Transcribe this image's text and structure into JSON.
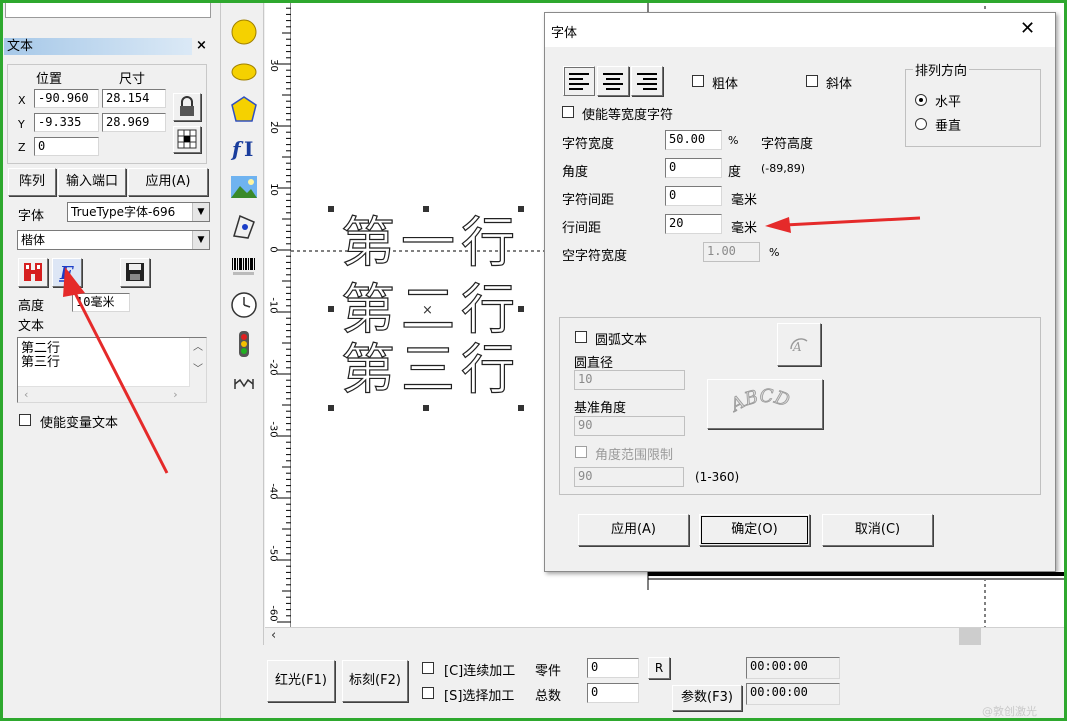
{
  "left_panel": {
    "title": "文本",
    "close": "×",
    "labels": {
      "position": "位置",
      "size": "尺寸",
      "x": "X",
      "y": "Y",
      "z": "Z"
    },
    "x_pos": "-90.960",
    "x_size": "28.154",
    "y_pos": "-9.335",
    "y_size": "28.969",
    "z_pos": "0",
    "buttons": {
      "array": "阵列",
      "input_port": "输入端口",
      "apply": "应用(A)"
    },
    "font_label": "字体",
    "font_type": "TrueType字体-696",
    "font_name": "楷体",
    "height_label": "高度",
    "height_value": "10毫米",
    "text_label": "文本",
    "text_lines": [
      "第二行",
      "第三行"
    ],
    "variable_text": "使能变量文本"
  },
  "canvas": {
    "lines": [
      "第一行",
      "第二行",
      "第三行"
    ],
    "ruler_labels": [
      "30",
      "20",
      "10",
      "0",
      "-10",
      "-20",
      "-30",
      "-40",
      "-50",
      "-60"
    ]
  },
  "dialog": {
    "title": "字体",
    "close": "✕",
    "bold": "粗体",
    "italic": "斜体",
    "equal_width": "使能等宽度字符",
    "char_width_label": "字符宽度",
    "char_width_value": "50.00",
    "char_width_unit": "%",
    "char_height_label": "字符高度",
    "angle_label": "角度",
    "angle_value": "0",
    "angle_unit": "度",
    "angle_range": "(-89,89)",
    "char_spacing_label": "字符间距",
    "char_spacing_value": "0",
    "char_spacing_unit": "毫米",
    "line_spacing_label": "行间距",
    "line_spacing_value": "20",
    "line_spacing_unit": "毫米",
    "space_width_label": "空字符宽度",
    "space_width_value": "1.00",
    "space_width_unit": "%",
    "arrange_title": "排列方向",
    "horizontal": "水平",
    "vertical": "垂直",
    "arc_text": "圆弧文本",
    "diameter_label": "圆直径",
    "diameter_value": "10",
    "base_angle_label": "基准角度",
    "base_angle_value": "90",
    "angle_limit": "角度范围限制",
    "angle_limit_value": "90",
    "angle_limit_range": "(1-360)",
    "preview_text": "ABCD",
    "apply": "应用(A)",
    "ok": "确定(O)",
    "cancel": "取消(C)"
  },
  "bottom_bar": {
    "red_light": "红光(F1)",
    "mark": "标刻(F2)",
    "continuous": "[C]连续加工",
    "select_process": "[S]选择加工",
    "parts_label": "零件",
    "parts_value": "0",
    "total_label": "总数",
    "total_value": "0",
    "r_button": "R",
    "params": "参数(F3)",
    "time1": "00:00:00",
    "time2": "00:00:00"
  },
  "watermark": "@敦创激光"
}
